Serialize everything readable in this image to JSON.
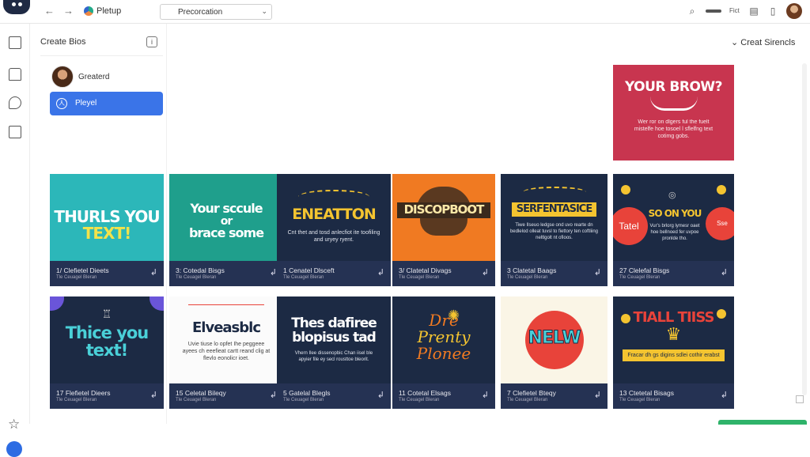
{
  "topbar": {
    "app_title": "Pletup",
    "dropdown_value": "Precorcation",
    "right_text": "Fict"
  },
  "panel": {
    "title": "Create Bios",
    "item1_label": "Greaterd",
    "item2_label": "Pleyel"
  },
  "main": {
    "header": "Creat Sirencls",
    "hero": {
      "heading": "YOUR BROW?",
      "body": "Wer ror on dlgers ful the fuelt mistelfe hoe tosoel l sflelfng text cotimg gobs."
    }
  },
  "cards": [
    {
      "headline": "THURLS YOU",
      "headline2": "TEXT!",
      "title": "1/ Clefietel Dieets",
      "sub": "Tle Ceuagel Bleran"
    },
    {
      "headline": "Your sccule",
      "headline2": "or",
      "headline3": "brace some",
      "title": "3: Cotedal Bisgs",
      "sub": "Tle Ceuagel Bleran"
    },
    {
      "headline": "ENEATTON",
      "body": "Cnt thet and tosd anlecfiot ite toofiling and uryey ryent.",
      "title": "1 Cenatel Dlsceft",
      "sub": "Tle Ceuagel Bleran"
    },
    {
      "headline": "DISCOPBOOT",
      "title": "3/ Clatetal Divags",
      "sub": "Tle Ceuagel Bleran"
    },
    {
      "headline": "SERFENTASICE",
      "body": "Tiwe Ilseuo ledgse ond uvo rearte dn bedlelod olleat tuvsl to fiettory ten coftliing neltlgolt nt ofioos.",
      "title": "3 Clatetal Baags",
      "sub": "Tle Ceuagel Bleran"
    },
    {
      "headline": "SO ON YOU",
      "left_circle": "Tatel",
      "right_circle": "Sse",
      "body": "Vur's brlorg lymesr oaet hoe bellnoed fer uvpoe pronlde tho.",
      "title": "27 Clelefal Bisgs",
      "sub": "Tle Ceuagel Bleran"
    },
    {
      "headline": "Thice you",
      "headline2": "text!",
      "title": "17 Flefietel Dieers",
      "sub": "Tle Ceuagel Bleran"
    },
    {
      "headline": "Elveasblc",
      "body": "Uvie tiuse lo opfet Ihe peggeee ayees ch eeefieat cartt reand clig at flevlo eonolicr ioet.",
      "title": "15 Celetal Bileqy",
      "sub": "Tle Ceuagel Bleran"
    },
    {
      "headline": "Thes dafiree",
      "headline2": "blopisus tad",
      "body": "Vhern Ilee dissenopbic Chan iisel ble apyier file ey secl rousttoe bleorit.",
      "title": "5 Gatelal Blegls",
      "sub": "Tle Ceuagel Bleran"
    },
    {
      "headline": "Dre",
      "headline2": "Prenty",
      "headline3": "Plonee",
      "title": "11 Cotetal Elsags",
      "sub": "Tle Ceuagel Bleran"
    },
    {
      "headline": "NELW",
      "title": "7 Clefietel Bteqy",
      "sub": "Tle Ceuagel Bleran"
    },
    {
      "headline": "TIALL TIISS",
      "body": "Fracar dh gs digins sdlei cothir erabst",
      "title": "13 Ctetetal Bisags",
      "sub": "Tle Ceuagel Bleran"
    }
  ],
  "colors": {
    "accent": "#3a74e8",
    "hero_bg": "#c8354f",
    "card_footer": "#253253"
  }
}
